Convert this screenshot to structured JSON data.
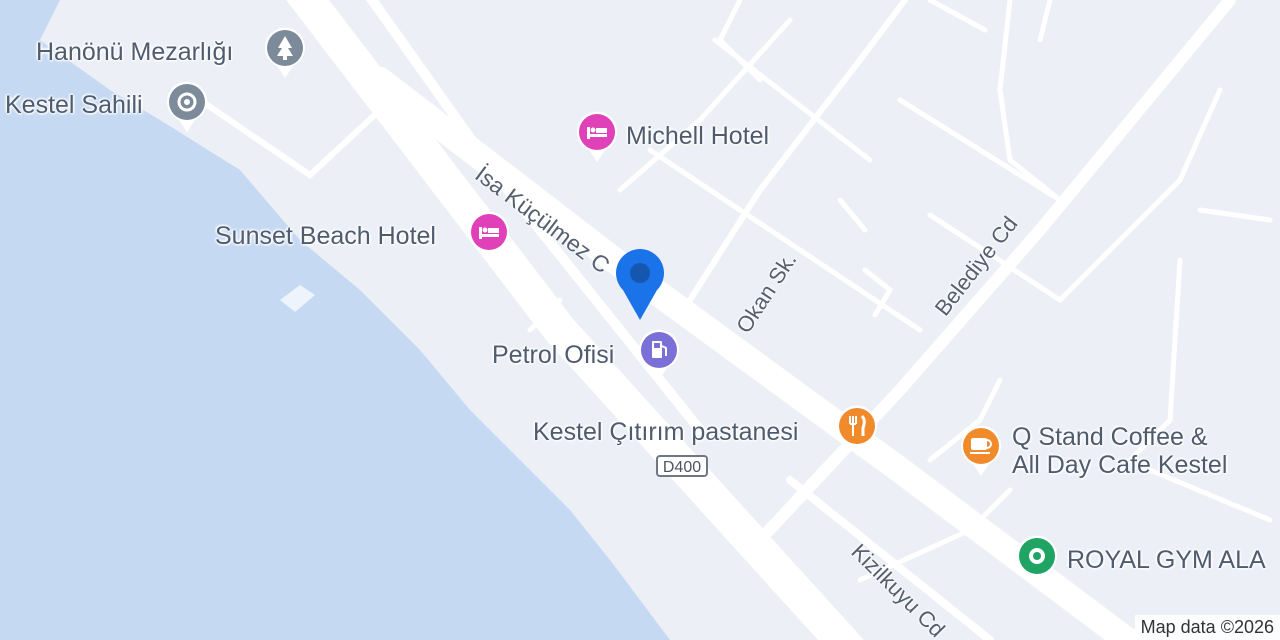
{
  "map": {
    "places": [
      {
        "id": "hanonu",
        "label": "Hanönü Mezarlığı",
        "icon": "cemetery-icon",
        "color": "#7c8a9a"
      },
      {
        "id": "kestel-sahili",
        "label": "Kestel Sahili",
        "icon": "place-icon",
        "color": "#7c8a9a"
      },
      {
        "id": "michell",
        "label": "Michell Hotel",
        "icon": "hotel-icon",
        "color": "#e040b8"
      },
      {
        "id": "sunset",
        "label": "Sunset Beach Hotel",
        "icon": "hotel-icon",
        "color": "#e040b8"
      },
      {
        "id": "petrol",
        "label": "Petrol Ofisi",
        "icon": "gas-station-icon",
        "color": "#7b6fd8"
      },
      {
        "id": "citirim",
        "label": "Kestel Çıtırım pastanesi",
        "icon": "restaurant-icon",
        "color": "#f08a2b"
      },
      {
        "id": "qstand",
        "label_line1": "Q Stand Coffee &",
        "label_line2": "All Day Cafe Kestel",
        "icon": "cafe-icon",
        "color": "#f08a2b"
      },
      {
        "id": "royal",
        "label": "ROYAL GYM ALA",
        "icon": "gym-icon",
        "color": "#1fa463"
      }
    ],
    "roads": {
      "isa": "İsa Küçülmez C",
      "okan": "Okan Sk.",
      "belediye": "Belediye Cd",
      "kizilkuyu": "Kizilkuyu Cd"
    },
    "highway_shield": "D400",
    "location_pin_color": "#1a73e8",
    "attribution": "Map data ©2026"
  }
}
